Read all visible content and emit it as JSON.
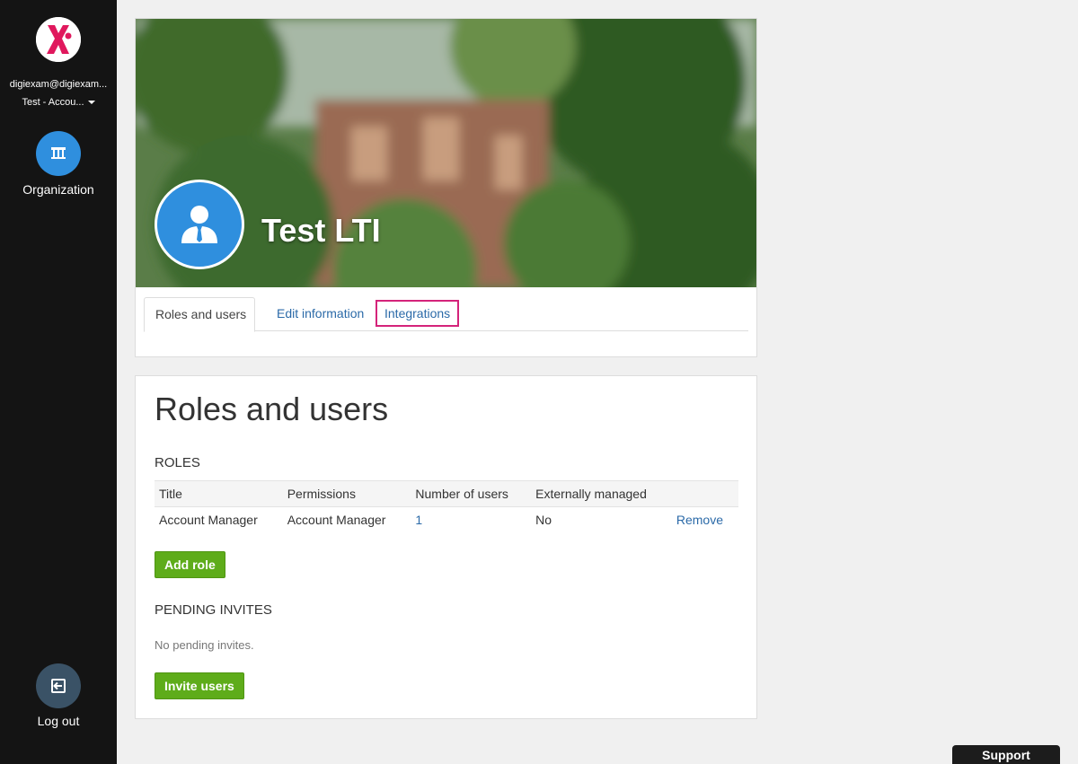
{
  "sidebar": {
    "user_email": "digiexam@digiexam...",
    "account": "Test - Accou...",
    "nav": {
      "organization_label": "Organization"
    },
    "logout_label": "Log out"
  },
  "header": {
    "org_name": "Test LTI",
    "tabs": [
      {
        "label": "Roles and users",
        "active": true
      },
      {
        "label": "Edit information",
        "active": false
      },
      {
        "label": "Integrations",
        "active": false,
        "highlighted": true
      }
    ]
  },
  "main": {
    "title": "Roles and users",
    "roles_heading": "ROLES",
    "roles_table": {
      "headers": [
        "Title",
        "Permissions",
        "Number of users",
        "Externally managed",
        ""
      ],
      "rows": [
        {
          "title": "Account Manager",
          "permissions": "Account Manager",
          "users": "1",
          "external": "No",
          "action": "Remove"
        }
      ]
    },
    "add_role_label": "Add role",
    "pending_heading": "PENDING INVITES",
    "no_pending": "No pending invites.",
    "invite_label": "Invite users"
  },
  "support_label": "Support",
  "colors": {
    "sidebar_bg": "#141414",
    "accent_blue": "#2f8fde",
    "link_blue": "#2b6aa8",
    "button_green": "#5eac1a",
    "highlight_pink": "#d4237a",
    "logo_pink": "#e0185d"
  }
}
